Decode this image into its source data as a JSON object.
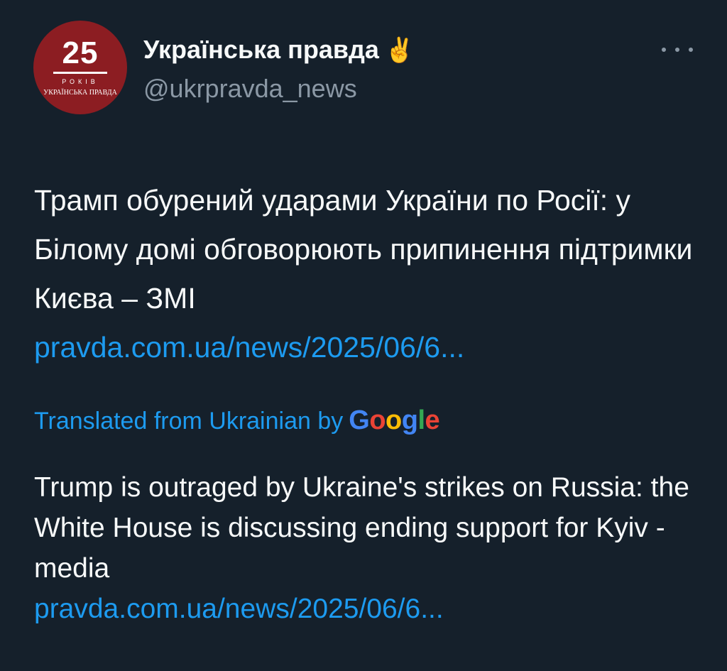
{
  "avatar": {
    "number": "25",
    "years": "РОКІВ",
    "brand": "УКРАЇНСЬКА ПРАВДА"
  },
  "author": {
    "display_name": "Українська правда",
    "emoji": "✌️",
    "handle": "@ukrpravda_news"
  },
  "tweet": {
    "text": "Трамп обурений ударами України по Росії: у Білому домі обговорюють припинення підтримки Києва – ЗМІ",
    "link": "pravda.com.ua/news/2025/06/6..."
  },
  "translation": {
    "label": "Translated from Ukrainian by",
    "provider": [
      "G",
      "o",
      "o",
      "g",
      "l",
      "e"
    ],
    "provider_colors": [
      "#4285f4",
      "#ea4335",
      "#fbbc05",
      "#4285f4",
      "#34a853",
      "#ea4335"
    ],
    "text": "Trump is outraged by Ukraine's strikes on Russia: the White House is discussing ending support for Kyiv - media",
    "link": "pravda.com.ua/news/2025/06/6..."
  },
  "colors": {
    "background": "#15202b",
    "text": "#f7f9f9",
    "secondary": "#8b98a5",
    "link": "#1d9bf0",
    "avatar_bg": "#8c1d22"
  }
}
